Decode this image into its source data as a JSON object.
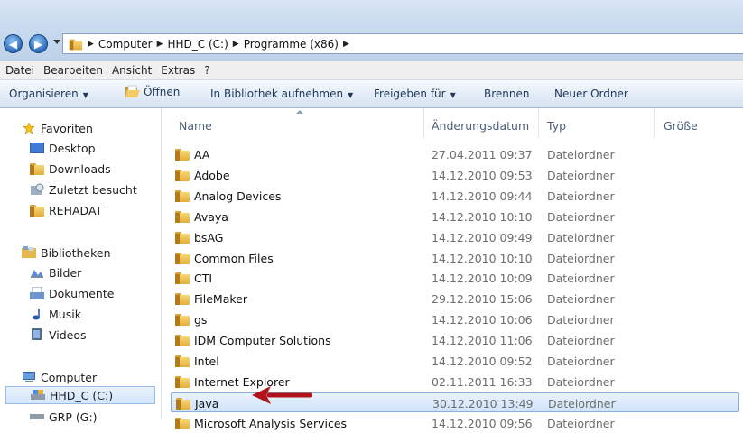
{
  "address": {
    "crumbs": [
      "Computer",
      "HHD_C (C:)",
      "Programme (x86)"
    ]
  },
  "menu": [
    "Datei",
    "Bearbeiten",
    "Ansicht",
    "Extras",
    "?"
  ],
  "toolbar": {
    "organize": "Organisieren",
    "open": "Öffnen",
    "library": "In Bibliothek aufnehmen",
    "share": "Freigeben für",
    "burn": "Brennen",
    "new_folder": "Neuer Ordner"
  },
  "sidebar": {
    "favorites": "Favoriten",
    "fav_items": [
      "Desktop",
      "Downloads",
      "Zuletzt besucht",
      "REHADAT"
    ],
    "libraries": "Bibliotheken",
    "lib_items": [
      "Bilder",
      "Dokumente",
      "Musik",
      "Videos"
    ],
    "computer": "Computer",
    "drives": [
      "HHD_C (C:)",
      "GRP (G:)"
    ]
  },
  "columns": {
    "name": "Name",
    "date": "Änderungsdatum",
    "type": "Typ",
    "size": "Größe"
  },
  "files": [
    {
      "name": "AA",
      "date": "27.04.2011 09:37",
      "type": "Dateiordner"
    },
    {
      "name": "Adobe",
      "date": "14.12.2010 09:53",
      "type": "Dateiordner"
    },
    {
      "name": "Analog Devices",
      "date": "14.12.2010 09:44",
      "type": "Dateiordner"
    },
    {
      "name": "Avaya",
      "date": "14.12.2010 10:10",
      "type": "Dateiordner"
    },
    {
      "name": "bsAG",
      "date": "14.12.2010 09:49",
      "type": "Dateiordner"
    },
    {
      "name": "Common Files",
      "date": "14.12.2010 10:10",
      "type": "Dateiordner"
    },
    {
      "name": "CTI",
      "date": "14.12.2010 10:09",
      "type": "Dateiordner"
    },
    {
      "name": "FileMaker",
      "date": "29.12.2010 15:06",
      "type": "Dateiordner"
    },
    {
      "name": "gs",
      "date": "14.12.2010 10:06",
      "type": "Dateiordner"
    },
    {
      "name": "IDM Computer Solutions",
      "date": "14.12.2010 11:06",
      "type": "Dateiordner"
    },
    {
      "name": "Intel",
      "date": "14.12.2010 09:52",
      "type": "Dateiordner"
    },
    {
      "name": "Internet Explorer",
      "date": "02.11.2011 16:33",
      "type": "Dateiordner"
    },
    {
      "name": "Java",
      "date": "30.12.2010 13:49",
      "type": "Dateiordner"
    },
    {
      "name": "Microsoft Analysis Services",
      "date": "14.12.2010 09:56",
      "type": "Dateiordner"
    }
  ],
  "selected_file": "Java",
  "colors": {
    "accent": "#2a6bbd",
    "annotation_arrow": "#b0141a"
  }
}
